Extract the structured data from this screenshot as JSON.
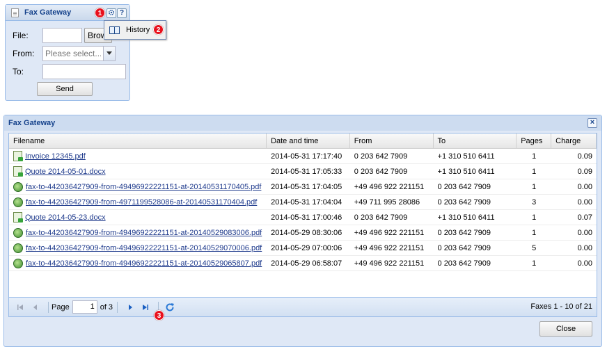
{
  "form_panel": {
    "title": "Fax Gateway",
    "settings_icon": "gear-icon",
    "help_label": "?",
    "badge_1": "1",
    "file_label": "File:",
    "file_value": "",
    "browse_label": "Browse...",
    "from_label": "From:",
    "from_placeholder": "Please select...",
    "to_label": "To:",
    "to_value": "",
    "send_label": "Send"
  },
  "menu": {
    "history_label": "History",
    "badge_2": "2"
  },
  "grid_window": {
    "title": "Fax Gateway",
    "close_label": "Close",
    "columns": [
      "Filename",
      "Date and time",
      "From",
      "To",
      "Pages",
      "Charge"
    ],
    "rows": [
      {
        "icon": "doc",
        "filename": "Invoice 12345.pdf",
        "date": "2014-05-31 17:17:40",
        "from": "0 203 642 7909",
        "to": "+1 310 510 6411",
        "pages": "1",
        "charge": "0.09"
      },
      {
        "icon": "doc",
        "filename": "Quote 2014-05-01.docx",
        "date": "2014-05-31 17:05:33",
        "from": "0 203 642 7909",
        "to": "+1 310 510 6411",
        "pages": "1",
        "charge": "0.09"
      },
      {
        "icon": "globe",
        "filename": "fax-to-442036427909-from-49496922221151-at-20140531170405.pdf",
        "date": "2014-05-31 17:04:05",
        "from": "+49 496 922 221151",
        "to": "0 203 642 7909",
        "pages": "1",
        "charge": "0.00"
      },
      {
        "icon": "globe",
        "filename": "fax-to-442036427909-from-4971199528086-at-20140531170404.pdf",
        "date": "2014-05-31 17:04:04",
        "from": "+49 711 995 28086",
        "to": "0 203 642 7909",
        "pages": "3",
        "charge": "0.00"
      },
      {
        "icon": "doc",
        "filename": "Quote 2014-05-23.docx",
        "date": "2014-05-31 17:00:46",
        "from": "0 203 642 7909",
        "to": "+1 310 510 6411",
        "pages": "1",
        "charge": "0.07"
      },
      {
        "icon": "globe",
        "filename": "fax-to-442036427909-from-49496922221151-at-20140529083006.pdf",
        "date": "2014-05-29 08:30:06",
        "from": "+49 496 922 221151",
        "to": "0 203 642 7909",
        "pages": "1",
        "charge": "0.00"
      },
      {
        "icon": "globe",
        "filename": "fax-to-442036427909-from-49496922221151-at-20140529070006.pdf",
        "date": "2014-05-29 07:00:06",
        "from": "+49 496 922 221151",
        "to": "0 203 642 7909",
        "pages": "5",
        "charge": "0.00"
      },
      {
        "icon": "globe",
        "filename": "fax-to-442036427909-from-49496922221151-at-20140529065807.pdf",
        "date": "2014-05-29 06:58:07",
        "from": "+49 496 922 221151",
        "to": "0 203 642 7909",
        "pages": "1",
        "charge": "0.00"
      }
    ],
    "paging": {
      "page_label": "Page",
      "page_value": "1",
      "of_label": "of 3",
      "info": "Faxes 1 - 10 of 21",
      "badge_3": "3"
    }
  }
}
